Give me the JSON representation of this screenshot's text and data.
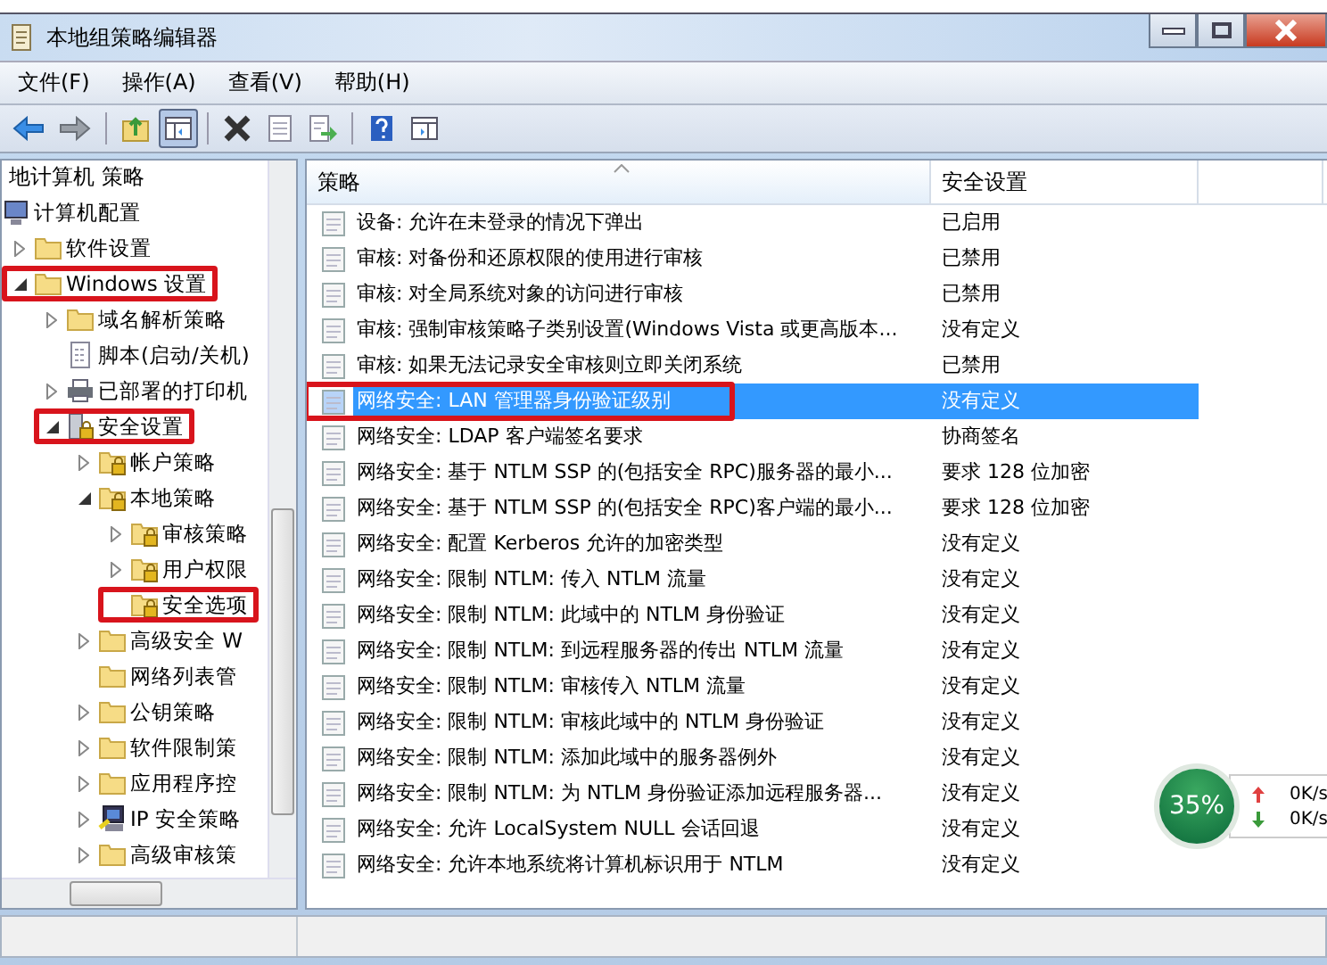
{
  "window": {
    "title": "本地组策略编辑器"
  },
  "menu": [
    "文件(F)",
    "操作(A)",
    "查看(V)",
    "帮助(H)"
  ],
  "toolbar": [
    {
      "kind": "back",
      "pressed": false
    },
    {
      "kind": "forward",
      "pressed": false
    },
    {
      "kind": "separator"
    },
    {
      "kind": "up",
      "pressed": false
    },
    {
      "kind": "tree",
      "pressed": true
    },
    {
      "kind": "separator"
    },
    {
      "kind": "delete",
      "pressed": false
    },
    {
      "kind": "properties",
      "pressed": false
    },
    {
      "kind": "export",
      "pressed": false
    },
    {
      "kind": "separator"
    },
    {
      "kind": "help",
      "pressed": false
    },
    {
      "kind": "panel",
      "pressed": false
    }
  ],
  "tree_pane": {
    "root_label": "地计算机 策略",
    "items": [
      {
        "label": "计算机配置",
        "kind": "computer",
        "marked": false,
        "children": [
          {
            "label": "软件设置",
            "kind": "folder",
            "expandable": true,
            "expanded": false,
            "marked": false
          },
          {
            "label": "Windows 设置",
            "kind": "folder",
            "expandable": true,
            "expanded": true,
            "marked": true,
            "children": [
              {
                "label": "域名解析策略",
                "kind": "folder",
                "expandable": true,
                "expanded": false,
                "marked": false
              },
              {
                "label": "脚本(启动/关机)",
                "kind": "script",
                "expandable": false,
                "marked": false
              },
              {
                "label": "已部署的打印机",
                "kind": "printer",
                "expandable": true,
                "expanded": false,
                "marked": false
              },
              {
                "label": "安全设置",
                "kind": "security",
                "expandable": true,
                "expanded": true,
                "marked": true,
                "children": [
                  {
                    "label": "帐户策略",
                    "kind": "locked-folder",
                    "expandable": true,
                    "expanded": false,
                    "marked": false
                  },
                  {
                    "label": "本地策略",
                    "kind": "locked-folder",
                    "expandable": true,
                    "expanded": true,
                    "marked": false,
                    "children": [
                      {
                        "label": "审核策略",
                        "kind": "locked-folder",
                        "expandable": true,
                        "expanded": false,
                        "marked": false
                      },
                      {
                        "label": "用户权限",
                        "kind": "locked-folder",
                        "expandable": true,
                        "expanded": false,
                        "marked": false
                      },
                      {
                        "label": "安全选项",
                        "kind": "locked-folder",
                        "expandable": false,
                        "marked": true
                      }
                    ]
                  },
                  {
                    "label": "高级安全 W",
                    "kind": "folder",
                    "expandable": true,
                    "expanded": false,
                    "marked": false
                  },
                  {
                    "label": "网络列表管",
                    "kind": "folder",
                    "expandable": false,
                    "marked": false
                  },
                  {
                    "label": "公钥策略",
                    "kind": "folder",
                    "expandable": true,
                    "expanded": false,
                    "marked": false
                  },
                  {
                    "label": "软件限制策",
                    "kind": "folder",
                    "expandable": true,
                    "expanded": false,
                    "marked": false
                  },
                  {
                    "label": "应用程序控",
                    "kind": "folder",
                    "expandable": true,
                    "expanded": false,
                    "marked": false
                  },
                  {
                    "label": "IP 安全策略",
                    "kind": "ip-security",
                    "expandable": true,
                    "expanded": false,
                    "marked": false
                  },
                  {
                    "label": "高级审核策",
                    "kind": "folder",
                    "expandable": true,
                    "expanded": false,
                    "marked": false
                  }
                ]
              }
            ]
          }
        ]
      }
    ]
  },
  "policy_list": {
    "columns": [
      "策略",
      "安全设置"
    ],
    "rows": [
      {
        "policy": "设备: 允许在未登录的情况下弹出",
        "setting": "已启用",
        "selected": false,
        "marked": false
      },
      {
        "policy": "审核: 对备份和还原权限的使用进行审核",
        "setting": "已禁用",
        "selected": false,
        "marked": false
      },
      {
        "policy": "审核: 对全局系统对象的访问进行审核",
        "setting": "已禁用",
        "selected": false,
        "marked": false
      },
      {
        "policy": "审核: 强制审核策略子类别设置(Windows Vista 或更高版本...",
        "setting": "没有定义",
        "selected": false,
        "marked": false
      },
      {
        "policy": "审核: 如果无法记录安全审核则立即关闭系统",
        "setting": "已禁用",
        "selected": false,
        "marked": false
      },
      {
        "policy": "网络安全: LAN 管理器身份验证级别",
        "setting": "没有定义",
        "selected": true,
        "marked": true
      },
      {
        "policy": "网络安全: LDAP 客户端签名要求",
        "setting": "协商签名",
        "selected": false,
        "marked": false
      },
      {
        "policy": "网络安全: 基于 NTLM SSP 的(包括安全 RPC)服务器的最小...",
        "setting": "要求 128 位加密",
        "selected": false,
        "marked": false
      },
      {
        "policy": "网络安全: 基于 NTLM SSP 的(包括安全 RPC)客户端的最小...",
        "setting": "要求 128 位加密",
        "selected": false,
        "marked": false
      },
      {
        "policy": "网络安全: 配置 Kerberos 允许的加密类型",
        "setting": "没有定义",
        "selected": false,
        "marked": false
      },
      {
        "policy": "网络安全: 限制 NTLM: 传入 NTLM 流量",
        "setting": "没有定义",
        "selected": false,
        "marked": false
      },
      {
        "policy": "网络安全: 限制 NTLM: 此域中的 NTLM 身份验证",
        "setting": "没有定义",
        "selected": false,
        "marked": false
      },
      {
        "policy": "网络安全: 限制 NTLM: 到远程服务器的传出 NTLM 流量",
        "setting": "没有定义",
        "selected": false,
        "marked": false
      },
      {
        "policy": "网络安全: 限制 NTLM: 审核传入 NTLM 流量",
        "setting": "没有定义",
        "selected": false,
        "marked": false
      },
      {
        "policy": "网络安全: 限制 NTLM: 审核此域中的 NTLM 身份验证",
        "setting": "没有定义",
        "selected": false,
        "marked": false
      },
      {
        "policy": "网络安全: 限制 NTLM: 添加此域中的服务器例外",
        "setting": "没有定义",
        "selected": false,
        "marked": false
      },
      {
        "policy": "网络安全: 限制 NTLM: 为 NTLM 身份验证添加远程服务器...",
        "setting": "没有定义",
        "selected": false,
        "marked": false
      },
      {
        "policy": "网络安全: 允许 LocalSystem NULL 会话回退",
        "setting": "没有定义",
        "selected": false,
        "marked": false
      },
      {
        "policy": "网络安全: 允许本地系统将计算机标识用于 NTLM",
        "setting": "没有定义",
        "selected": false,
        "marked": false
      }
    ]
  },
  "speed_widget": {
    "percent": "35%",
    "upload": "0K/s",
    "download": "0K/s"
  }
}
